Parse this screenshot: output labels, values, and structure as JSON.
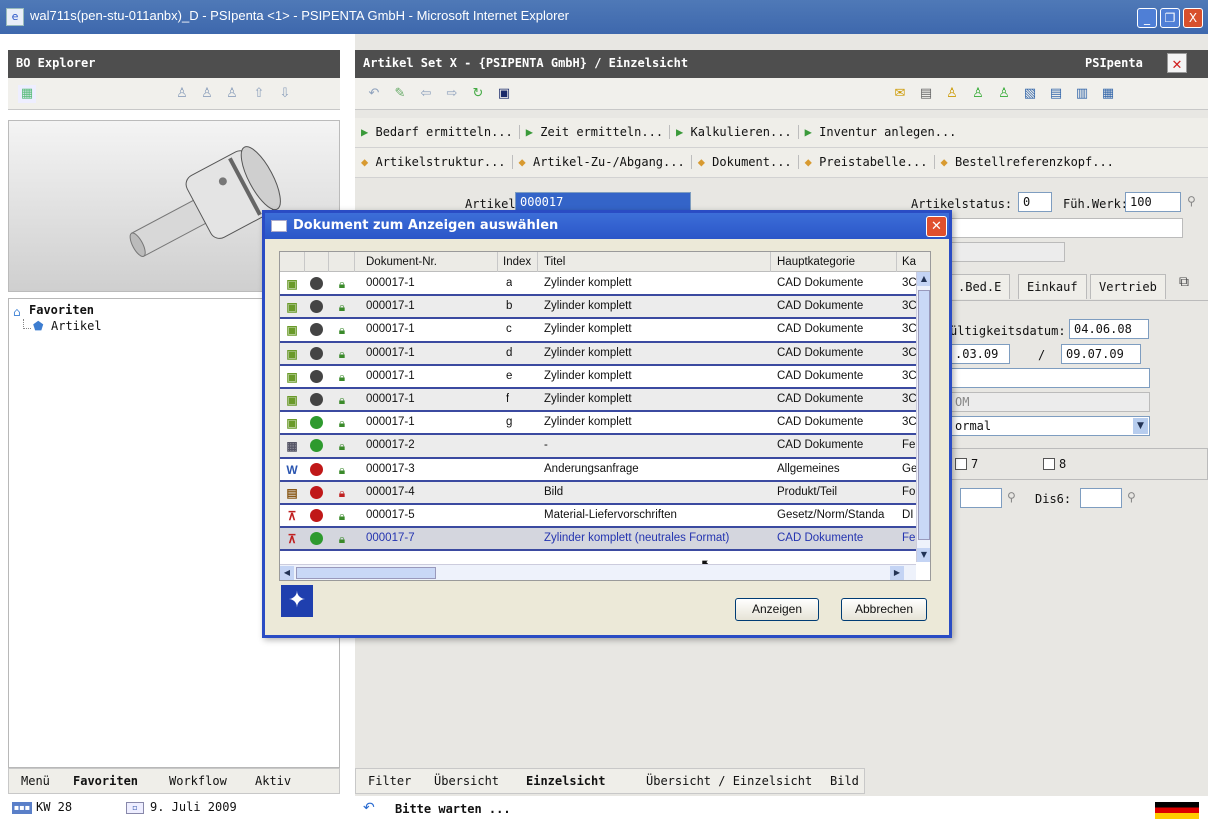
{
  "window": {
    "title": "wal711s(pen-stu-011anbx)_D - PSIpenta <1> - PSIPENTA GmbH - Microsoft Internet Explorer",
    "min": "_",
    "max": "❐",
    "close": "X"
  },
  "left": {
    "header": "BO Explorer",
    "tree": {
      "root": "Favoriten",
      "child": "Artikel"
    },
    "bottom_tabs": [
      "Menü",
      "Favoriten",
      "Workflow",
      "Aktiv"
    ],
    "status_week": "KW 28",
    "status_date": "9. Juli 2009"
  },
  "right": {
    "header": "Artikel  Set X - {PSIPENTA GmbH} / Einzelsicht",
    "brand": "PSIpenta",
    "actions_row1": [
      "Bedarf ermitteln...",
      "Zeit ermitteln...",
      "Kalkulieren...",
      "Inventur anlegen..."
    ],
    "actions_row2": [
      "Artikelstruktur...",
      "Artikel-Zu-/Abgang...",
      "Dokument...",
      "Preistabelle...",
      "Bestellreferenzkopf..."
    ],
    "artikel_label": "Artikel:",
    "artikel_value": "000017",
    "status_label": "Artikelstatus:",
    "status_value": "0",
    "werk_label": "Füh.Werk:",
    "werk_value": "100",
    "form_tabs": [
      ".Bed.E",
      "Einkauf",
      "Vertrieb"
    ],
    "validity_label": "ültigkeitsdatum:",
    "validity_value": "04.06.08",
    "date_from": ".03.09",
    "date_sep": "/",
    "date_to": "09.07.09",
    "select1": "OM",
    "select2": "ormal",
    "cb7": "7",
    "cb8": "8",
    "dis6_label": "Dis6:",
    "bottom_tabs": [
      "Filter",
      "Übersicht",
      "Einzelsicht",
      "Übersicht / Einzelsicht",
      "Bild"
    ],
    "status_text": "Bitte warten ..."
  },
  "dialog": {
    "title": "Dokument zum Anzeigen auswählen",
    "columns": [
      "Dokument-Nr.",
      "Index",
      "Titel",
      "Hauptkategorie",
      "Ka"
    ],
    "rows": [
      {
        "nr": "000017-1",
        "idx": "a",
        "titel": "Zylinder komplett",
        "kat": "CAD Dokumente",
        "ka": "3C",
        "status": "grey",
        "type": "cad"
      },
      {
        "nr": "000017-1",
        "idx": "b",
        "titel": "Zylinder komplett",
        "kat": "CAD Dokumente",
        "ka": "3C",
        "status": "grey",
        "type": "cad"
      },
      {
        "nr": "000017-1",
        "idx": "c",
        "titel": "Zylinder komplett",
        "kat": "CAD Dokumente",
        "ka": "3C",
        "status": "grey",
        "type": "cad"
      },
      {
        "nr": "000017-1",
        "idx": "d",
        "titel": "Zylinder komplett",
        "kat": "CAD Dokumente",
        "ka": "3C",
        "status": "grey",
        "type": "cad"
      },
      {
        "nr": "000017-1",
        "idx": "e",
        "titel": "Zylinder komplett",
        "kat": "CAD Dokumente",
        "ka": "3C",
        "status": "grey",
        "type": "cad"
      },
      {
        "nr": "000017-1",
        "idx": "f",
        "titel": "Zylinder komplett",
        "kat": "CAD Dokumente",
        "ka": "3C",
        "status": "grey",
        "type": "cad"
      },
      {
        "nr": "000017-1",
        "idx": "g",
        "titel": "Zylinder komplett",
        "kat": "CAD Dokumente",
        "ka": "3C",
        "status": "green",
        "type": "cad"
      },
      {
        "nr": "000017-2",
        "idx": "",
        "titel": "-",
        "kat": "CAD Dokumente",
        "ka": "Fe",
        "status": "green",
        "type": "drw"
      },
      {
        "nr": "000017-3",
        "idx": "",
        "titel": "Änderungsanfrage",
        "kat": "Allgemeines",
        "ka": "Ge",
        "status": "red",
        "type": "word"
      },
      {
        "nr": "000017-4",
        "idx": "",
        "titel": "Bild",
        "kat": "Produkt/Teil",
        "ka": "Fo",
        "status": "red",
        "type": "img"
      },
      {
        "nr": "000017-5",
        "idx": "",
        "titel": "Material-Liefervorschriften",
        "kat": "Gesetz/Norm/Standa",
        "ka": "DI",
        "status": "red",
        "type": "pdf"
      },
      {
        "nr": "000017-7",
        "idx": "",
        "titel": "Zylinder komplett (neutrales Format)",
        "kat": "CAD Dokumente",
        "ka": "Fe",
        "status": "green",
        "type": "pdf"
      }
    ],
    "btn_show": "Anzeigen",
    "btn_cancel": "Abbrechen"
  },
  "colors": {
    "accent": "#2b56c8",
    "title_bg": "#3e68ad",
    "dark_header": "#4e4e4e",
    "red": "#c01818",
    "green": "#2e9a2e",
    "grey": "#444444"
  }
}
